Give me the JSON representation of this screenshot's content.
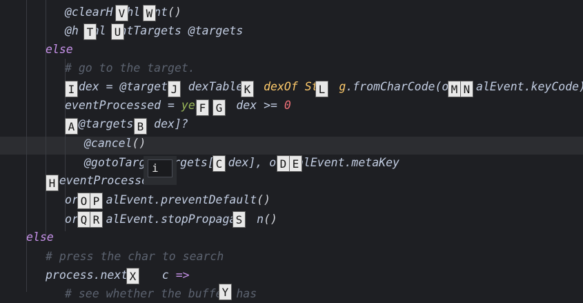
{
  "lines": [
    {
      "indent": 94,
      "tokens": [
        {
          "c": "c-ivar",
          "t": "@clearH"
        },
        {
          "c": "c-ivar",
          "t": "  "
        },
        {
          "c": "c-ivar",
          "t": "hl"
        },
        {
          "c": "c-ivar",
          "t": "  "
        },
        {
          "c": "c-ivar",
          "t": "nt"
        },
        {
          "c": "c-pl",
          "t": "()"
        }
      ]
    },
    {
      "indent": 94,
      "tokens": [
        {
          "c": "c-ivar",
          "t": "@h  hl  ntTargets @targets"
        }
      ]
    },
    {
      "indent": 66,
      "tokens": [
        {
          "c": "c-kw",
          "t": "else"
        }
      ]
    },
    {
      "indent": 94,
      "tokens": [
        {
          "c": "c-cm",
          "t": "# go to the target."
        }
      ]
    },
    {
      "indent": 94,
      "tokens": [
        {
          "c": "c-ivar",
          "t": "  dex = @targets  dexTable.  "
        },
        {
          "c": "c-yel",
          "t": "dexOf Str  g"
        },
        {
          "c": "c-ivar",
          "t": ".fromCharCode(or   alEvent.keyCode)."
        }
      ]
    },
    {
      "indent": 94,
      "tokens": [
        {
          "c": "c-ivar",
          "t": "eventProcessed = "
        },
        {
          "c": "c-grn",
          "t": "yes"
        },
        {
          "c": "c-ivar",
          "t": "     dex >= "
        },
        {
          "c": "c-num",
          "t": "0"
        }
      ]
    },
    {
      "indent": 94,
      "tokens": [
        {
          "c": "c-ivar",
          "t": "  @targets[  dex]?"
        }
      ]
    },
    {
      "indent": 122,
      "tokens": [
        {
          "c": "c-ivar",
          "t": "@cancel"
        },
        {
          "c": "c-pl",
          "t": "()"
        }
      ]
    },
    {
      "indent": 122,
      "tokens": [
        {
          "c": "c-ivar",
          "t": "@gotoTarg"
        },
        {
          "c": "c-ivar",
          "t": "   "
        },
        {
          "c": "c-ivar",
          "t": "argets[  dex], or  alEvent.metaKey"
        }
      ]
    },
    {
      "indent": 66,
      "tokens": [
        {
          "c": "c-ivar",
          "t": "  eventProcesse"
        }
      ]
    },
    {
      "indent": 94,
      "tokens": [
        {
          "c": "c-ivar",
          "t": "or    alEvent.preventDefault"
        },
        {
          "c": "c-pl",
          "t": "()"
        }
      ]
    },
    {
      "indent": 94,
      "tokens": [
        {
          "c": "c-ivar",
          "t": "or    alEvent.stopPropagat  n"
        },
        {
          "c": "c-pl",
          "t": "()"
        }
      ]
    },
    {
      "indent": 38,
      "tokens": [
        {
          "c": "c-kw",
          "t": "else"
        }
      ]
    },
    {
      "indent": 66,
      "tokens": [
        {
          "c": "c-cm",
          "t": "# press the char to search"
        }
      ]
    },
    {
      "indent": 66,
      "tokens": [
        {
          "c": "c-ivar",
          "t": "process.nextT    c "
        },
        {
          "c": "c-kw",
          "t": "=>"
        }
      ]
    },
    {
      "indent": 94,
      "tokens": [
        {
          "c": "c-cm",
          "t": "# see whether the buffer has"
        }
      ]
    }
  ],
  "hints": [
    "V",
    "W",
    "T",
    "U",
    "I",
    "J",
    "K",
    "L",
    "M",
    "N",
    "F",
    "G",
    "A",
    "B",
    "C",
    "D",
    "E",
    "H",
    "O",
    "P",
    "Q",
    "R",
    "S",
    "X",
    "Y"
  ],
  "popup": {
    "value": "i"
  }
}
